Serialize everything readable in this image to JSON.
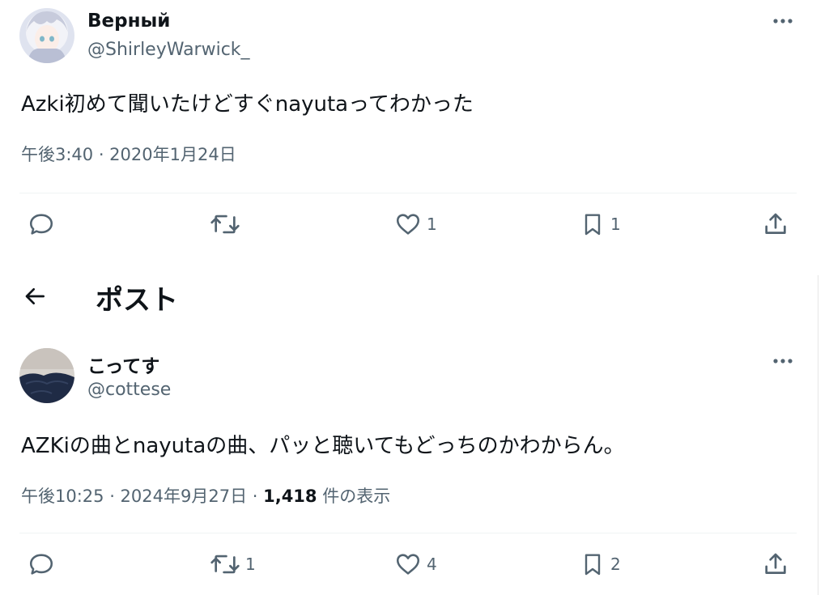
{
  "tweet1": {
    "display_name": "Верный",
    "handle": "@ShirleyWarwick_",
    "text": "Azki初めて聞いたけどすぐnayutaってわかった",
    "meta": "午後3:40 · 2020年1月24日",
    "actions": {
      "reply_icon": "reply-icon",
      "retweet_icon": "retweet-icon",
      "like_count": "1",
      "bookmark_count": "1",
      "share_icon": "share-icon"
    }
  },
  "header": {
    "back_icon": "back-arrow-icon",
    "title": "ポスト"
  },
  "tweet2": {
    "display_name": "こってす",
    "handle": "@cottese",
    "text": "AZKiの曲とnayutaの曲、パッと聴いてもどっちのかわからん。",
    "meta_time": "午後10:25 · 2024年9月27日 · ",
    "views_count": "1,418",
    "views_label": " 件の表示",
    "actions": {
      "retweet_count": "1",
      "like_count": "4",
      "bookmark_count": "2"
    }
  },
  "colors": {
    "text_primary": "#0f1419",
    "text_secondary": "#536471",
    "divider": "#eff3f4"
  }
}
